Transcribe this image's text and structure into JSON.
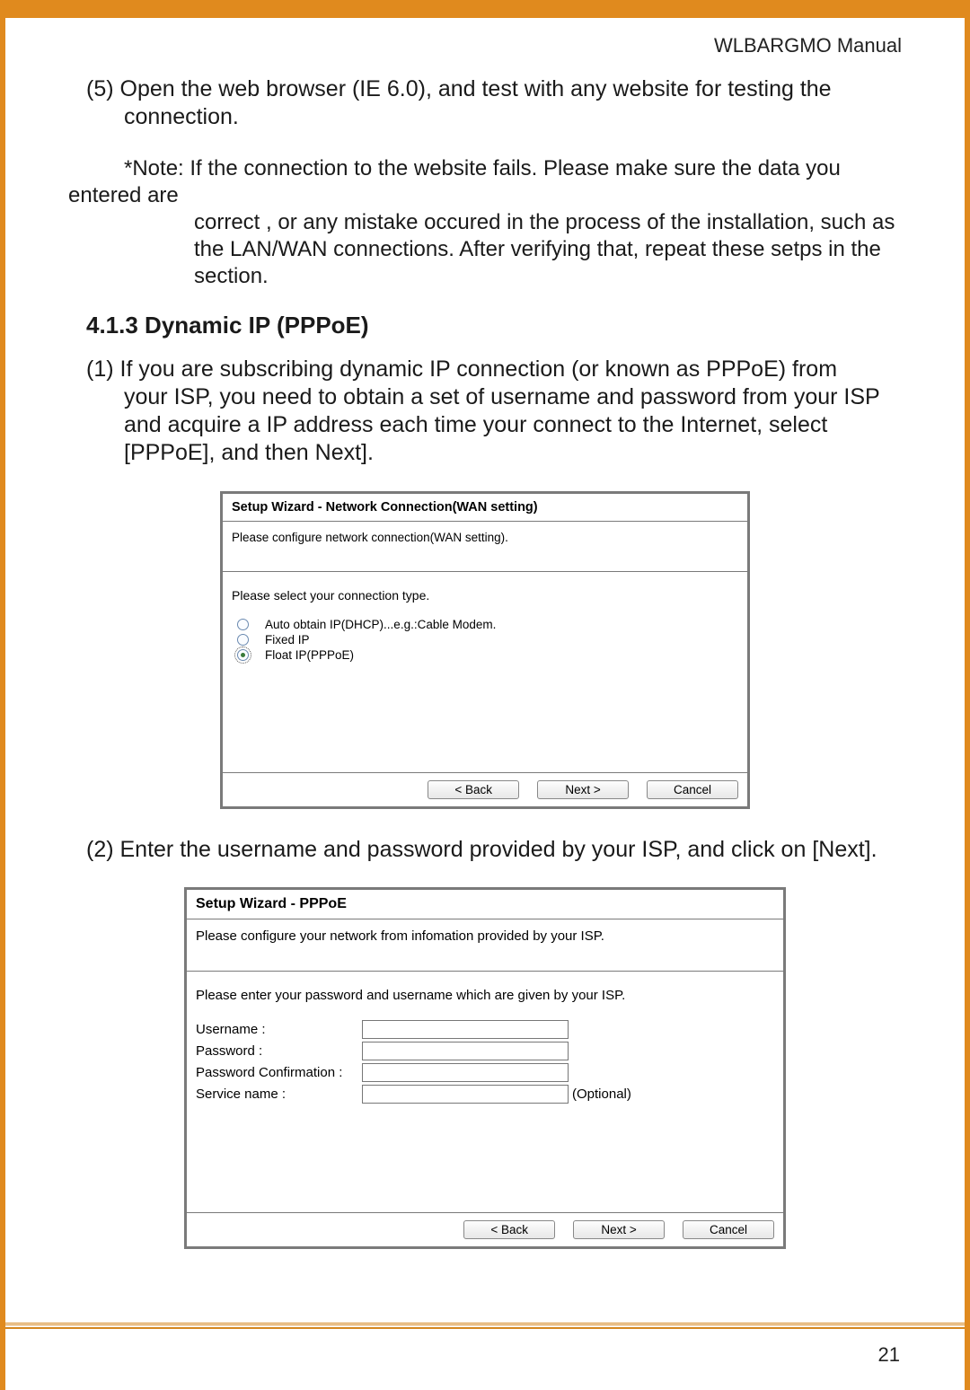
{
  "header": {
    "manual_title": "WLBARGMO Manual"
  },
  "body": {
    "step5_num": "(5) ",
    "step5_first": "Open the web browser (IE 6.0), and test with any website for testing the",
    "step5_rest": "connection.",
    "note_label": "*Note: ",
    "note_first": "If the connection to the website fails. Please make sure the data you entered are",
    "note_rest": "correct , or any mistake occured in the process of the installation, such as the LAN/WAN connections. After verifying that, repeat these setps in the section.",
    "section_heading": "4.1.3 Dynamic IP (PPPoE)",
    "step1_num": "(1) ",
    "step1_first": "If you are subscribing dynamic IP connection (or known as PPPoE) from",
    "step1_rest": "your ISP, you need to obtain a set of username and password from your ISP and acquire a IP address each time your connect to the Internet, select [PPPoE], and then Next].",
    "step2_num": "(2) ",
    "step2_text": "Enter the username and password provided by your ISP, and click on [Next]."
  },
  "wizard1": {
    "title": "Setup Wizard - Network Connection(WAN setting)",
    "subtitle": "Please configure network connection(WAN setting).",
    "prompt": "Please select your connection type.",
    "options": [
      {
        "label": "Auto obtain IP(DHCP)...e.g.:Cable Modem.",
        "selected": false
      },
      {
        "label": "Fixed IP",
        "selected": false
      },
      {
        "label": "Float IP(PPPoE)",
        "selected": true
      }
    ],
    "buttons": {
      "back": "< Back",
      "next": "Next >",
      "cancel": "Cancel"
    }
  },
  "wizard2": {
    "title": "Setup Wizard - PPPoE",
    "subtitle": "Please configure your network from infomation provided by your ISP.",
    "prompt": "Please enter your password and username which are given by your ISP.",
    "fields": {
      "username": "Username :",
      "password": "Password :",
      "password_confirm": "Password Confirmation :",
      "service_name": "Service name :",
      "optional_tag": "(Optional)"
    },
    "buttons": {
      "back": "< Back",
      "next": "Next >",
      "cancel": "Cancel"
    }
  },
  "footer": {
    "page_number": "21"
  }
}
